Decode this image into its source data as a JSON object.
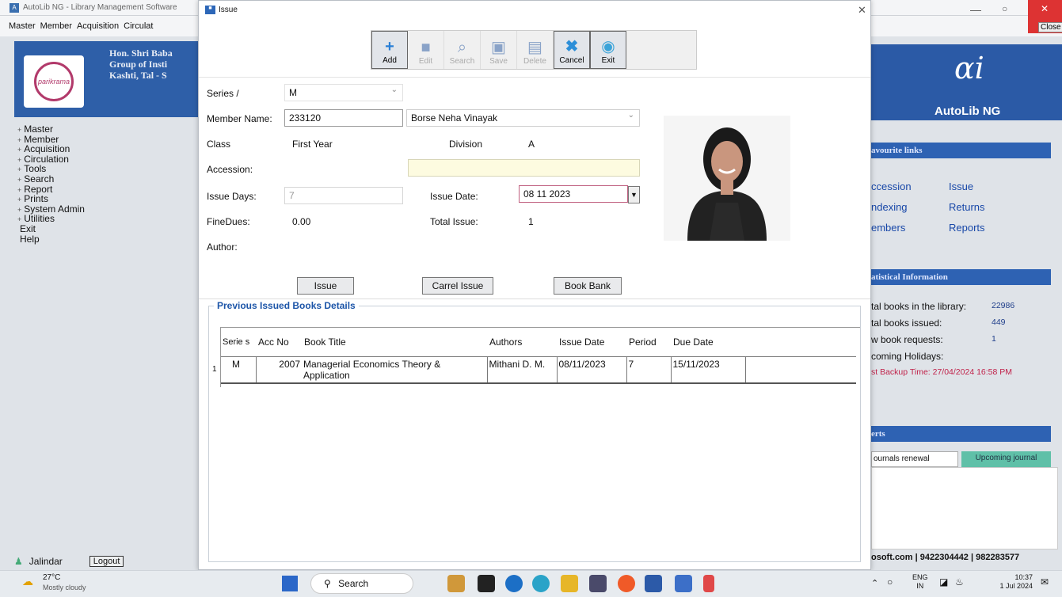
{
  "app": {
    "title": "AutoLib NG - Library Management Software",
    "menu": [
      "Master",
      "Member",
      "Acquisition",
      "Circulat"
    ],
    "banner_lines": [
      "Hon. Shri Baba",
      "Group of Insti",
      "Kashti, Tal - S"
    ],
    "logo_text": "parikrama",
    "tree": [
      {
        "label": "Master",
        "expand": "+"
      },
      {
        "label": "Member",
        "expand": "+"
      },
      {
        "label": "Acquisition",
        "expand": "+"
      },
      {
        "label": "Circulation",
        "expand": "+"
      },
      {
        "label": "Tools",
        "expand": "+"
      },
      {
        "label": "Search",
        "expand": "+"
      },
      {
        "label": "Report",
        "expand": "+"
      },
      {
        "label": "Prints",
        "expand": "+"
      },
      {
        "label": "System Admin",
        "expand": "+"
      },
      {
        "label": "Utilities",
        "expand": "+"
      },
      {
        "label": "Exit",
        "expand": ""
      },
      {
        "label": "Help",
        "expand": ""
      }
    ],
    "user": "Jalindar",
    "logout": "Logout",
    "close_label": "Close"
  },
  "right_panel": {
    "brand": "AutoLib NG",
    "favourite_title": "avourite links",
    "links": [
      [
        "ccession",
        "Issue"
      ],
      [
        "ndexing",
        "Returns"
      ],
      [
        "embers",
        "Reports"
      ]
    ],
    "stat_title": "atistical Information",
    "stats": [
      {
        "label": "tal books in the library:",
        "value": "22986"
      },
      {
        "label": "tal books issued:",
        "value": "449"
      },
      {
        "label": "w book requests:",
        "value": "1"
      },
      {
        "label": "coming Holidays:",
        "value": ""
      }
    ],
    "backup": "st Backup Time: 27/04/2024 16:58 PM",
    "alerts_title": "erts",
    "alert_tabs": [
      "ournals renewal",
      "Upcoming journal"
    ],
    "footer": "osoft.com | 9422304442 | 982283577"
  },
  "dialog": {
    "title": "Issue",
    "toolbar": [
      {
        "label": "Add",
        "glyph": "+",
        "enabled": true,
        "cls": "g-add"
      },
      {
        "label": "Edit",
        "glyph": "■",
        "enabled": false,
        "cls": "g-dis"
      },
      {
        "label": "Search",
        "glyph": "⌕",
        "enabled": false,
        "cls": "g-dis"
      },
      {
        "label": "Save",
        "glyph": "▣",
        "enabled": false,
        "cls": "g-dis"
      },
      {
        "label": "Delete",
        "glyph": "▤",
        "enabled": false,
        "cls": "g-dis"
      },
      {
        "label": "Cancel",
        "glyph": "✖",
        "enabled": true,
        "cls": "g-cancel"
      },
      {
        "label": "Exit",
        "glyph": "◉",
        "enabled": true,
        "cls": "g-exit"
      }
    ],
    "form": {
      "series_label": "Series /",
      "series_value": "M",
      "member_label": "Member Name:",
      "member_id": "233120",
      "member_name": "Borse Neha Vinayak",
      "class_label": "Class",
      "class_value": "First Year",
      "division_label": "Division",
      "division_value": "A",
      "accession_label": "Accession:",
      "accession_value": "",
      "issue_days_label": "Issue Days:",
      "issue_days_value": "7",
      "issue_date_label": "Issue Date:",
      "issue_date_value": "08 11 2023",
      "fine_label": "FineDues:",
      "fine_value": "0.00",
      "total_issue_label": "Total Issue:",
      "total_issue_value": "1",
      "author_label": "Author:"
    },
    "buttons": {
      "issue": "Issue",
      "carrel": "Carrel Issue",
      "book_bank": "Book Bank"
    },
    "previous": {
      "legend": "Previous Issued Books Details",
      "headers": [
        "Serie s",
        "Acc No",
        "Book Title",
        "Authors",
        "Issue Date",
        "Period",
        "Due Date"
      ],
      "rows": [
        {
          "n": "1",
          "series": "M",
          "acc": "2007",
          "title": "Managerial Economics Theory & Application",
          "author": "Mithani D. M.",
          "issue": "08/11/2023",
          "period": "7",
          "due": "15/11/2023"
        }
      ]
    }
  },
  "taskbar": {
    "weather_temp": "27°C",
    "weather_desc": "Mostly cloudy",
    "search": "Search",
    "lang": "ENG",
    "region": "IN",
    "time": "10:37",
    "date": "1 Jul 2024"
  }
}
